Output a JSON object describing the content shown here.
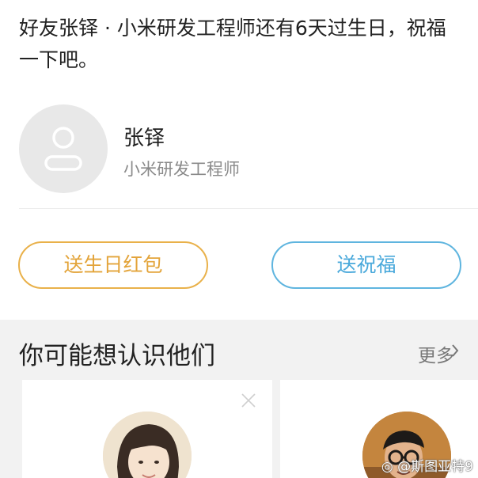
{
  "birthday_notice": {
    "text": "好友张铎 · 小米研发工程师还有6天过生日，祝福一下吧。"
  },
  "contact": {
    "name": "张铎",
    "title": "小米研发工程师",
    "avatar_icon": "person-placeholder-icon"
  },
  "actions": {
    "red_packet_label": "送生日红包",
    "bless_label": "送祝福",
    "red_packet_color": "#e3a43a",
    "bless_color": "#4aa9db"
  },
  "suggestions": {
    "title": "你可能想认识他们",
    "more_label": "更多",
    "more_icon": "chevron-right-icon",
    "close_icon": "close-icon",
    "cards": [
      {
        "avatar": "profile-photo-woman"
      },
      {
        "avatar": "profile-photo-man-glasses"
      }
    ]
  },
  "watermark": {
    "text": "@斯图亚特9",
    "icon": "weibo-logo-icon"
  }
}
